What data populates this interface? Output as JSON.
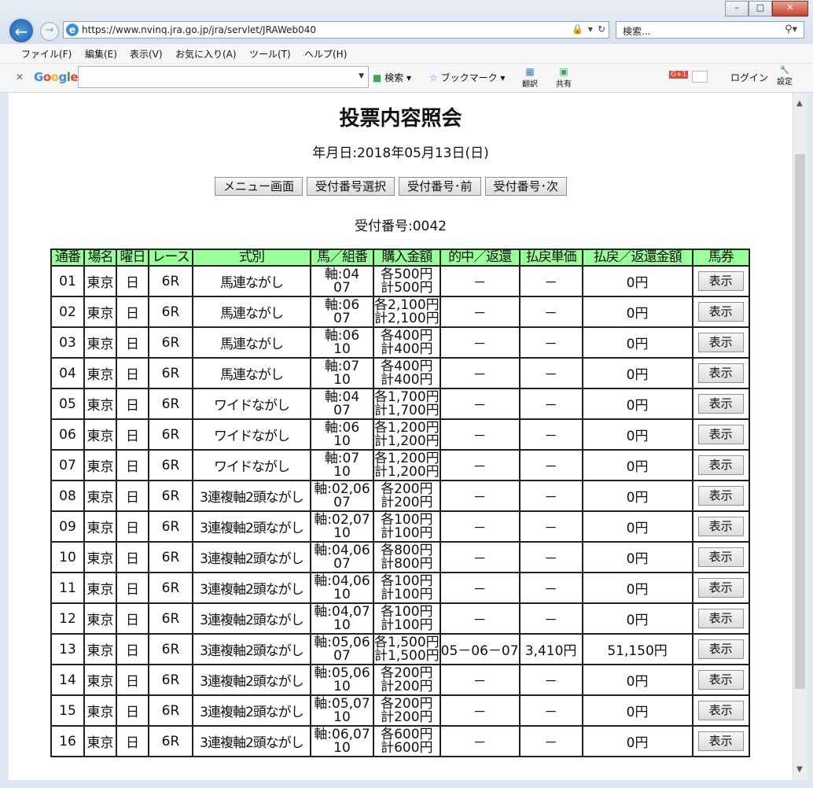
{
  "browser": {
    "url": "https://www.nvinq.jra.go.jp/jra/servlet/JRAWeb040",
    "search_placeholder": "検索...",
    "menu": [
      "ファイル(F)",
      "編集(E)",
      "表示(V)",
      "お気に入り(A)",
      "ツール(T)",
      "ヘルプ(H)"
    ],
    "google_toolbar": {
      "logo": "Google",
      "search_label": "検索",
      "bookmark_label": "ブックマーク",
      "translate_label": "翻訳",
      "share_label": "共有",
      "login_label": "ログイン",
      "settings_label": "設定"
    }
  },
  "page": {
    "title": "投票内容照会",
    "date": "年月日:2018年05月13日(日)",
    "buttons": [
      "メニュー画面",
      "受付番号選択",
      "受付番号･前",
      "受付番号･次"
    ],
    "receipt_number": "受付番号:0042"
  },
  "table": {
    "headers": [
      "通番",
      "場名",
      "曜日",
      "レース",
      "式別",
      "馬／組番",
      "購入金額",
      "的中／返還",
      "払戻単価",
      "払戻／返還金額",
      "馬券"
    ],
    "show_label": "表示",
    "rows": [
      {
        "no": "01",
        "venue": "東京",
        "day": "日",
        "race": "6R",
        "type": "馬連ながし",
        "combo1": "軸:04",
        "combo2": "07",
        "each": "各500円",
        "total": "計500円",
        "hit": "－",
        "unit": "－",
        "payout": "0円"
      },
      {
        "no": "02",
        "venue": "東京",
        "day": "日",
        "race": "6R",
        "type": "馬連ながし",
        "combo1": "軸:06",
        "combo2": "07",
        "each": "各2,100円",
        "total": "計2,100円",
        "hit": "－",
        "unit": "－",
        "payout": "0円"
      },
      {
        "no": "03",
        "venue": "東京",
        "day": "日",
        "race": "6R",
        "type": "馬連ながし",
        "combo1": "軸:06",
        "combo2": "10",
        "each": "各400円",
        "total": "計400円",
        "hit": "－",
        "unit": "－",
        "payout": "0円"
      },
      {
        "no": "04",
        "venue": "東京",
        "day": "日",
        "race": "6R",
        "type": "馬連ながし",
        "combo1": "軸:07",
        "combo2": "10",
        "each": "各400円",
        "total": "計400円",
        "hit": "－",
        "unit": "－",
        "payout": "0円"
      },
      {
        "no": "05",
        "venue": "東京",
        "day": "日",
        "race": "6R",
        "type": "ワイドながし",
        "combo1": "軸:04",
        "combo2": "07",
        "each": "各1,700円",
        "total": "計1,700円",
        "hit": "－",
        "unit": "－",
        "payout": "0円"
      },
      {
        "no": "06",
        "venue": "東京",
        "day": "日",
        "race": "6R",
        "type": "ワイドながし",
        "combo1": "軸:06",
        "combo2": "10",
        "each": "各1,200円",
        "total": "計1,200円",
        "hit": "－",
        "unit": "－",
        "payout": "0円"
      },
      {
        "no": "07",
        "venue": "東京",
        "day": "日",
        "race": "6R",
        "type": "ワイドながし",
        "combo1": "軸:07",
        "combo2": "10",
        "each": "各1,200円",
        "total": "計1,200円",
        "hit": "－",
        "unit": "－",
        "payout": "0円"
      },
      {
        "no": "08",
        "venue": "東京",
        "day": "日",
        "race": "6R",
        "type": "3連複軸2頭ながし",
        "combo1": "軸:02,06",
        "combo2": "07",
        "each": "各200円",
        "total": "計200円",
        "hit": "－",
        "unit": "－",
        "payout": "0円"
      },
      {
        "no": "09",
        "venue": "東京",
        "day": "日",
        "race": "6R",
        "type": "3連複軸2頭ながし",
        "combo1": "軸:02,07",
        "combo2": "10",
        "each": "各100円",
        "total": "計100円",
        "hit": "－",
        "unit": "－",
        "payout": "0円"
      },
      {
        "no": "10",
        "venue": "東京",
        "day": "日",
        "race": "6R",
        "type": "3連複軸2頭ながし",
        "combo1": "軸:04,06",
        "combo2": "07",
        "each": "各800円",
        "total": "計800円",
        "hit": "－",
        "unit": "－",
        "payout": "0円"
      },
      {
        "no": "11",
        "venue": "東京",
        "day": "日",
        "race": "6R",
        "type": "3連複軸2頭ながし",
        "combo1": "軸:04,06",
        "combo2": "10",
        "each": "各100円",
        "total": "計100円",
        "hit": "－",
        "unit": "－",
        "payout": "0円"
      },
      {
        "no": "12",
        "venue": "東京",
        "day": "日",
        "race": "6R",
        "type": "3連複軸2頭ながし",
        "combo1": "軸:04,07",
        "combo2": "10",
        "each": "各100円",
        "total": "計100円",
        "hit": "－",
        "unit": "－",
        "payout": "0円"
      },
      {
        "no": "13",
        "venue": "東京",
        "day": "日",
        "race": "6R",
        "type": "3連複軸2頭ながし",
        "combo1": "軸:05,06",
        "combo2": "07",
        "each": "各1,500円",
        "total": "計1,500円",
        "hit": "05－06－07",
        "unit": "3,410円",
        "payout": "51,150円"
      },
      {
        "no": "14",
        "venue": "東京",
        "day": "日",
        "race": "6R",
        "type": "3連複軸2頭ながし",
        "combo1": "軸:05,06",
        "combo2": "10",
        "each": "各200円",
        "total": "計200円",
        "hit": "－",
        "unit": "－",
        "payout": "0円"
      },
      {
        "no": "15",
        "venue": "東京",
        "day": "日",
        "race": "6R",
        "type": "3連複軸2頭ながし",
        "combo1": "軸:05,07",
        "combo2": "10",
        "each": "各200円",
        "total": "計200円",
        "hit": "－",
        "unit": "－",
        "payout": "0円"
      },
      {
        "no": "16",
        "venue": "東京",
        "day": "日",
        "race": "6R",
        "type": "3連複軸2頭ながし",
        "combo1": "軸:06,07",
        "combo2": "10",
        "each": "各600円",
        "total": "計600円",
        "hit": "－",
        "unit": "－",
        "payout": "0円"
      }
    ]
  }
}
